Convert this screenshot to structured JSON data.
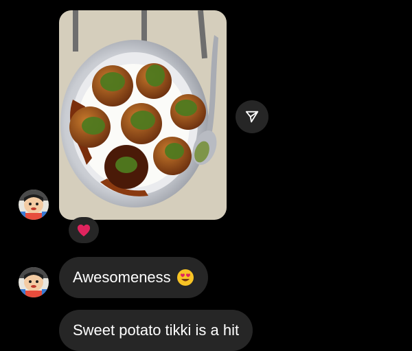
{
  "thread": {
    "photo_message": {
      "content": "photo",
      "share_icon": "send-paper-plane-icon",
      "reaction": "red-heart"
    },
    "messages": [
      {
        "text": "Awesomeness",
        "emoji": "heart-eyes-face"
      },
      {
        "text": "Sweet potato tikki is a hit"
      }
    ]
  },
  "colors": {
    "background": "#000000",
    "bubble": "#262626",
    "text": "#ffffff",
    "heart": "#e0245e"
  }
}
